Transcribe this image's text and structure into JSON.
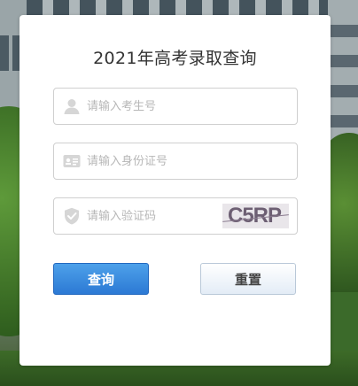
{
  "form": {
    "title": "2021年高考录取查询",
    "fields": [
      {
        "name": "candidate-number",
        "placeholder": "请输入考生号",
        "icon": "user-icon",
        "value": ""
      },
      {
        "name": "id-number",
        "placeholder": "请输入身份证号",
        "icon": "id-card-icon",
        "value": ""
      },
      {
        "name": "verification-code",
        "placeholder": "请输入验证码",
        "icon": "shield-check-icon",
        "value": "",
        "captcha_text": "C5RP"
      }
    ],
    "buttons": {
      "query_label": "查询",
      "reset_label": "重置"
    }
  },
  "colors": {
    "query_button": "#2c79d4",
    "reset_button": "#e3ecf6",
    "placeholder": "#b7b7b7",
    "icon": "#d6d6d6"
  }
}
